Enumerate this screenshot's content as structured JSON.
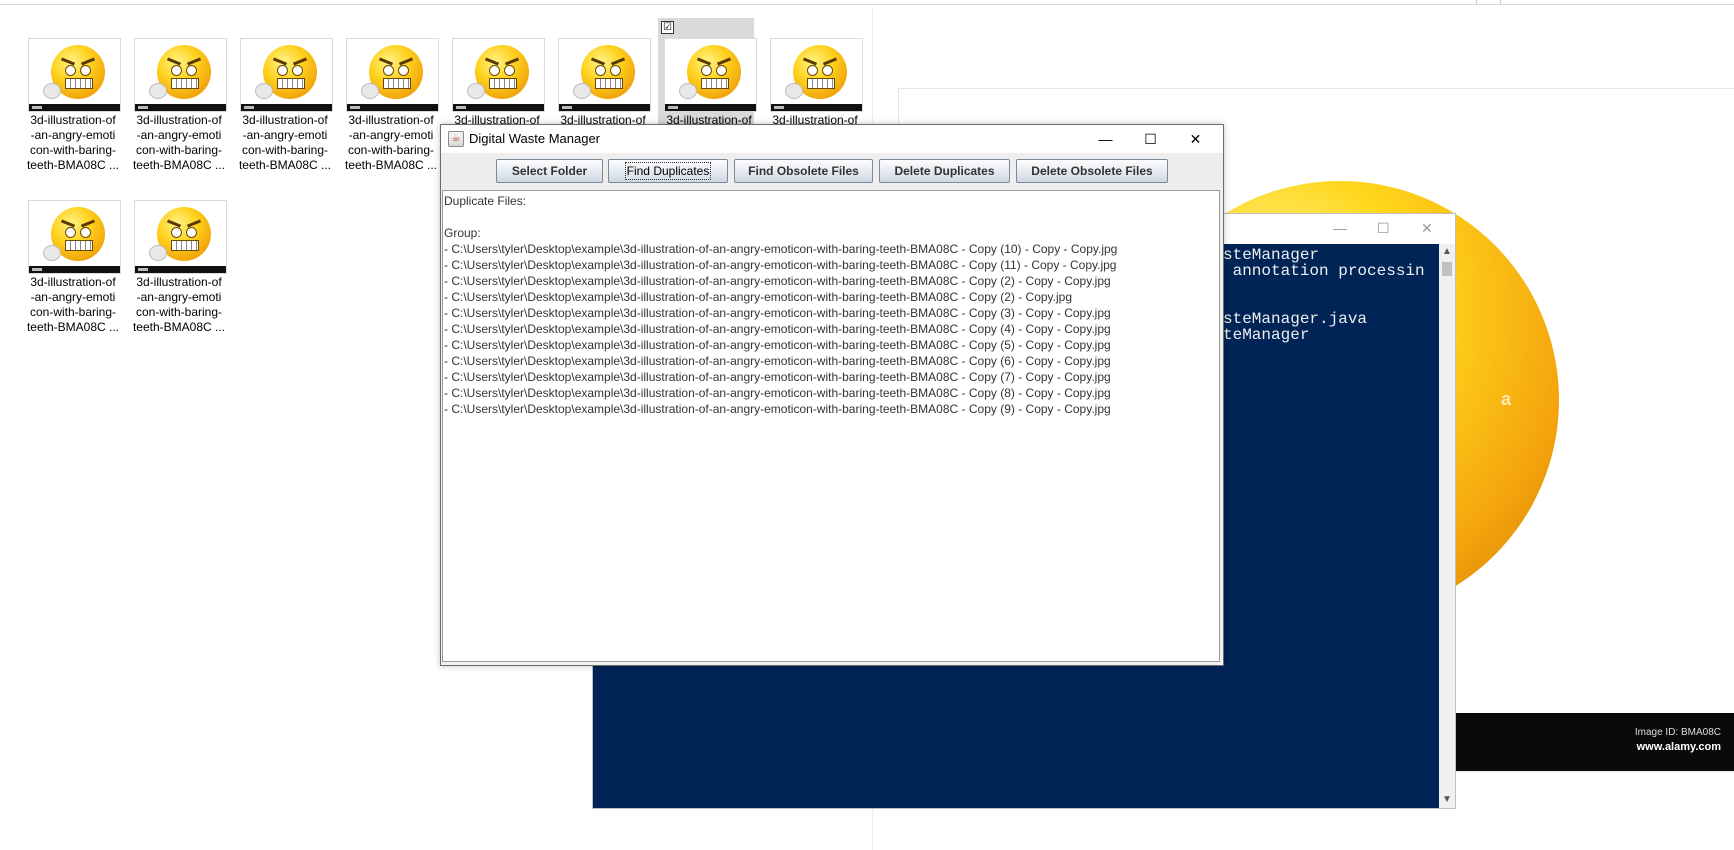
{
  "explorer": {
    "files": [
      {
        "name_lines": [
          "3d-illustration-of",
          "-an-angry-emoti",
          "con-with-baring-",
          "teeth-BMA08C ..."
        ]
      },
      {
        "name_lines": [
          "3d-illustration-of",
          "-an-angry-emoti",
          "con-with-baring-",
          "teeth-BMA08C ..."
        ]
      },
      {
        "name_lines": [
          "3d-illustration-of",
          "-an-angry-emoti",
          "con-with-baring-",
          "teeth-BMA08C ..."
        ]
      },
      {
        "name_lines": [
          "3d-illustration-of",
          "-an-angry-emoti",
          "con-with-baring-",
          "teeth-BMA08C ..."
        ]
      },
      {
        "name_lines": [
          "3d-illustration-of"
        ]
      },
      {
        "name_lines": [
          "3d-illustration-of"
        ]
      },
      {
        "name_lines": [
          "3d-illustration-of"
        ],
        "selected": true
      },
      {
        "name_lines": [
          "3d-illustration-of"
        ]
      },
      {
        "name_lines": [
          "3d-illustration-of",
          "-an-angry-emoti",
          "con-with-baring-",
          "teeth-BMA08C ..."
        ]
      },
      {
        "name_lines": [
          "3d-illustration-of",
          "-an-angry-emoti",
          "con-with-baring-",
          "teeth-BMA08C ..."
        ]
      }
    ],
    "selected_checkbox": "☑"
  },
  "photo_viewer": {
    "image_id": "Image ID: BMA08C",
    "site": "www.alamy.com",
    "watermark_a": "a"
  },
  "terminal": {
    "title_controls": [
      "—",
      "☐",
      "✕"
    ],
    "lines": [
      "steManager",
      " annotation processin",
      "",
      "",
      "steManager.java",
      "teManager"
    ]
  },
  "app": {
    "title": "Digital Waste Manager",
    "window_controls": {
      "minimize": "—",
      "maximize": "☐",
      "close": "✕"
    },
    "buttons": {
      "select_folder": "Select Folder",
      "find_duplicates": "Find Duplicates",
      "find_obsolete": "Find Obsolete Files",
      "delete_duplicates": "Delete Duplicates",
      "delete_obsolete": "Delete Obsolete Files"
    },
    "output": {
      "heading": "Duplicate Files:",
      "blank": "",
      "group_label": "Group:",
      "entries": [
        "- C:\\Users\\tyler\\Desktop\\example\\3d-illustration-of-an-angry-emoticon-with-baring-teeth-BMA08C - Copy (10) - Copy - Copy.jpg",
        "- C:\\Users\\tyler\\Desktop\\example\\3d-illustration-of-an-angry-emoticon-with-baring-teeth-BMA08C - Copy (11) - Copy - Copy.jpg",
        "- C:\\Users\\tyler\\Desktop\\example\\3d-illustration-of-an-angry-emoticon-with-baring-teeth-BMA08C - Copy (2) - Copy - Copy.jpg",
        "- C:\\Users\\tyler\\Desktop\\example\\3d-illustration-of-an-angry-emoticon-with-baring-teeth-BMA08C - Copy (2) - Copy.jpg",
        "- C:\\Users\\tyler\\Desktop\\example\\3d-illustration-of-an-angry-emoticon-with-baring-teeth-BMA08C - Copy (3) - Copy - Copy.jpg",
        "- C:\\Users\\tyler\\Desktop\\example\\3d-illustration-of-an-angry-emoticon-with-baring-teeth-BMA08C - Copy (4) - Copy - Copy.jpg",
        "- C:\\Users\\tyler\\Desktop\\example\\3d-illustration-of-an-angry-emoticon-with-baring-teeth-BMA08C - Copy (5) - Copy - Copy.jpg",
        "- C:\\Users\\tyler\\Desktop\\example\\3d-illustration-of-an-angry-emoticon-with-baring-teeth-BMA08C - Copy (6) - Copy - Copy.jpg",
        "- C:\\Users\\tyler\\Desktop\\example\\3d-illustration-of-an-angry-emoticon-with-baring-teeth-BMA08C - Copy (7) - Copy - Copy.jpg",
        "- C:\\Users\\tyler\\Desktop\\example\\3d-illustration-of-an-angry-emoticon-with-baring-teeth-BMA08C - Copy (8) - Copy - Copy.jpg",
        "- C:\\Users\\tyler\\Desktop\\example\\3d-illustration-of-an-angry-emoticon-with-baring-teeth-BMA08C - Copy (9) - Copy - Copy.jpg"
      ]
    }
  },
  "colors": {
    "terminal_bg": "#012456",
    "selection_bg": "#d9d9d9",
    "emoji_yellow": "#ffd21e"
  }
}
